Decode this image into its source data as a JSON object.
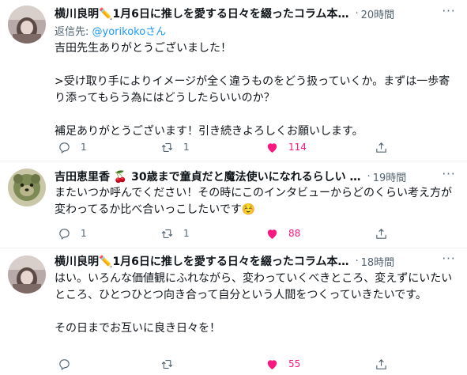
{
  "tweets": [
    {
      "author": "横川良明✏️1月6日に推しを愛する日々を綴ったコラム本…",
      "separator": "·",
      "time": "20時間",
      "more": "···",
      "reply_prefix": "返信先:",
      "reply_handle": "@yorikokoさん",
      "text": "吉田先生ありがとうございました！\n\n>受け取り手によりイメージが全く違うものをどう扱っていくか。まずは一歩寄り添ってもらう為にはどうしたらいいのか？\n\n補足ありがとうございます！引き続きよろしくお願いします。",
      "replies": "1",
      "retweets": "1",
      "likes": "114"
    },
    {
      "author": "吉田恵里香 🍒 30歳まで童貞だと魔法使いになれるらしい …",
      "separator": "·",
      "time": "19時間",
      "more": "···",
      "text": "またいつか呼んでください！その時にこのインタビューからどのくらい考え方が変わってるか比べ合いっこしたいです☺️",
      "replies": "1",
      "retweets": "1",
      "likes": "88"
    },
    {
      "author": "横川良明✏️1月6日に推しを愛する日々を綴ったコラム本…",
      "separator": "·",
      "time": "18時間",
      "more": "···",
      "text": "はい。いろんな価値観にふれながら、変わっていくべきところ、変えずにいたいところ、ひとつひとつ向き合って自分という人間をつくっていきたいです。\n\nその日までお互いに良き日々を！",
      "replies": "",
      "retweets": "",
      "likes": "55"
    }
  ],
  "colors": {
    "like": "#f91880",
    "link": "#1d9bf0",
    "muted": "#536471"
  },
  "icons": [
    "reply-icon",
    "retweet-icon",
    "like-icon",
    "share-icon",
    "more-icon"
  ]
}
